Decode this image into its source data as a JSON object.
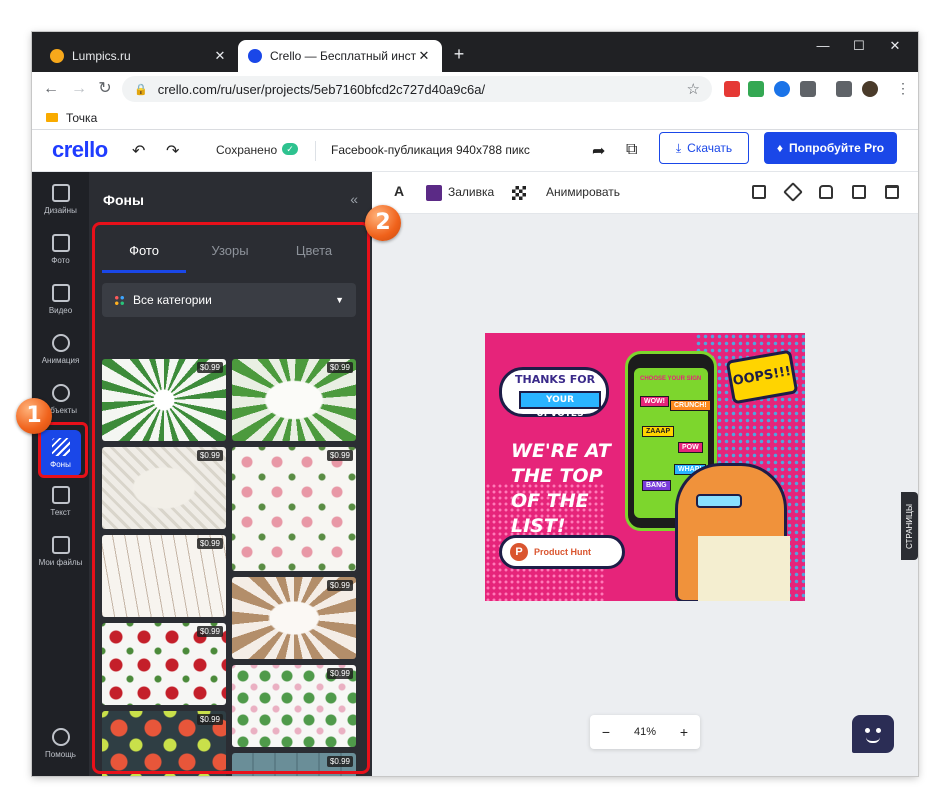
{
  "browser": {
    "tabs": [
      {
        "title": "Lumpics.ru",
        "close": "✕",
        "favicon_color": "#f7a81b"
      },
      {
        "title": "Crello — Бесплатный инструмен",
        "close": "✕",
        "favicon_color": "#1a47e8"
      }
    ],
    "new_tab": "+",
    "window_controls": {
      "minimize": "—",
      "maximize": "☐",
      "close": "✕"
    },
    "nav": {
      "back": "←",
      "forward": "→",
      "reload": "↻"
    },
    "url": "crello.com/ru/user/projects/5eb7160bfcd2c727d40a9c6a/",
    "lock": "🔒",
    "star": "☆",
    "menu": "⋮",
    "bookmark": "Точка"
  },
  "app": {
    "logo": "crello",
    "undo": "↶",
    "redo": "↷",
    "saved": "Сохранено",
    "cloud_check": "✓",
    "doc_title": "Facebook-публикация 940x788  пикс",
    "share": "➦",
    "resize": "⧉",
    "download": "Скачать",
    "download_icon": "⤓",
    "try_pro": "Попробуйте Pro",
    "pro_icon": "♦"
  },
  "leftnav": [
    {
      "label": "Дизайны"
    },
    {
      "label": "Фото"
    },
    {
      "label": "Видео"
    },
    {
      "label": "Анимация"
    },
    {
      "label": "Объекты"
    },
    {
      "label": "Фоны"
    },
    {
      "label": "Текст"
    },
    {
      "label": "Мои файлы"
    },
    {
      "label": "Помощь"
    }
  ],
  "panel": {
    "title": "Фоны",
    "collapse": "«",
    "tabs": [
      "Фото",
      "Узоры",
      "Цвета"
    ],
    "category": "Все категории",
    "caret": "▼",
    "price": "$0.99"
  },
  "badges": {
    "one": "1",
    "two": "2"
  },
  "canvas_toolbar": {
    "text_tool": "A",
    "fill": "Заливка",
    "fill_color": "#5b2a86",
    "animate": "Анимировать"
  },
  "artwork": {
    "thanks": "THANKS FOR",
    "upvotes": "YOUR UPVOTES",
    "headline": "WE'RE AT THE TOP OF THE LIST!",
    "product_hunt": "Product Hunt",
    "ph_letter": "P",
    "choose": "CHOOSE YOUR SIGN",
    "stickers": [
      "WOW!",
      "CRUNCH!",
      "ZAAAP",
      "POW",
      "WHAP!",
      "BANG"
    ],
    "oops": "OOPS!!!"
  },
  "pages": "СТРАНИЦЫ",
  "zoom": {
    "minus": "−",
    "value": "41%",
    "plus": "+"
  }
}
